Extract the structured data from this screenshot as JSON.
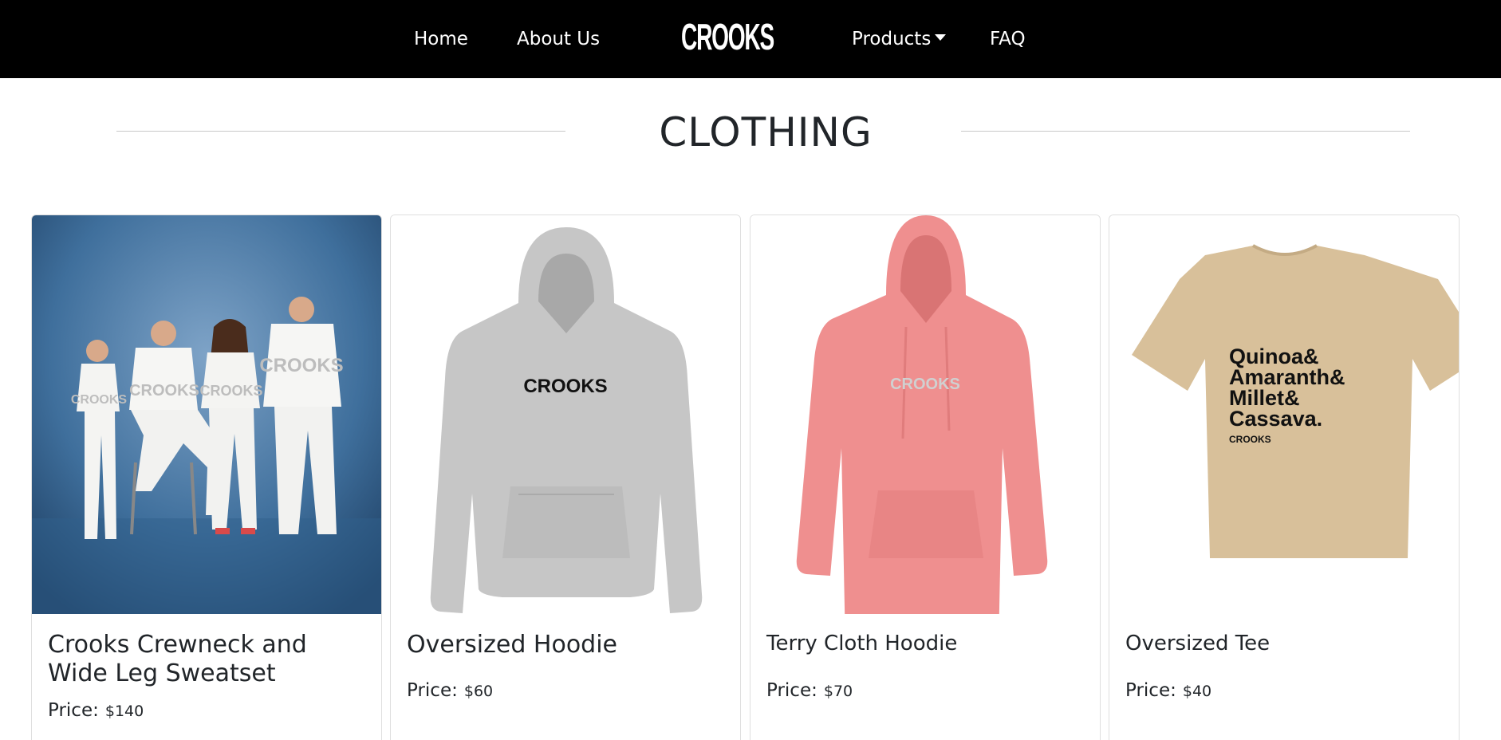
{
  "nav": {
    "home": "Home",
    "about": "About Us",
    "logo": "CROOKS",
    "products": "Products",
    "faq": "FAQ"
  },
  "section": {
    "title": "CLOTHING"
  },
  "products": [
    {
      "name": "Crooks Crewneck and Wide Leg Sweatset",
      "price_label": "Price:",
      "price": "$140",
      "print": "CROOKS"
    },
    {
      "name": "Oversized Hoodie",
      "price_label": "Price:",
      "price": "$60",
      "print": "CROOKS",
      "color": "#c6c6c6"
    },
    {
      "name": "Terry Cloth Hoodie",
      "price_label": "Price:",
      "price": "$70",
      "print": "CROOKS",
      "color": "#ef8f8f"
    },
    {
      "name": "Oversized Tee",
      "price_label": "Price:",
      "price": "$40",
      "print_lines": [
        "Quinoa&",
        "Amaranth&",
        "Millet&",
        "Cassava."
      ],
      "print_brand": "CROOKS",
      "color": "#d8c09a"
    }
  ],
  "colors": {
    "navbar": "#000000",
    "text": "#212529",
    "backdrop": "#3f6f9c"
  }
}
